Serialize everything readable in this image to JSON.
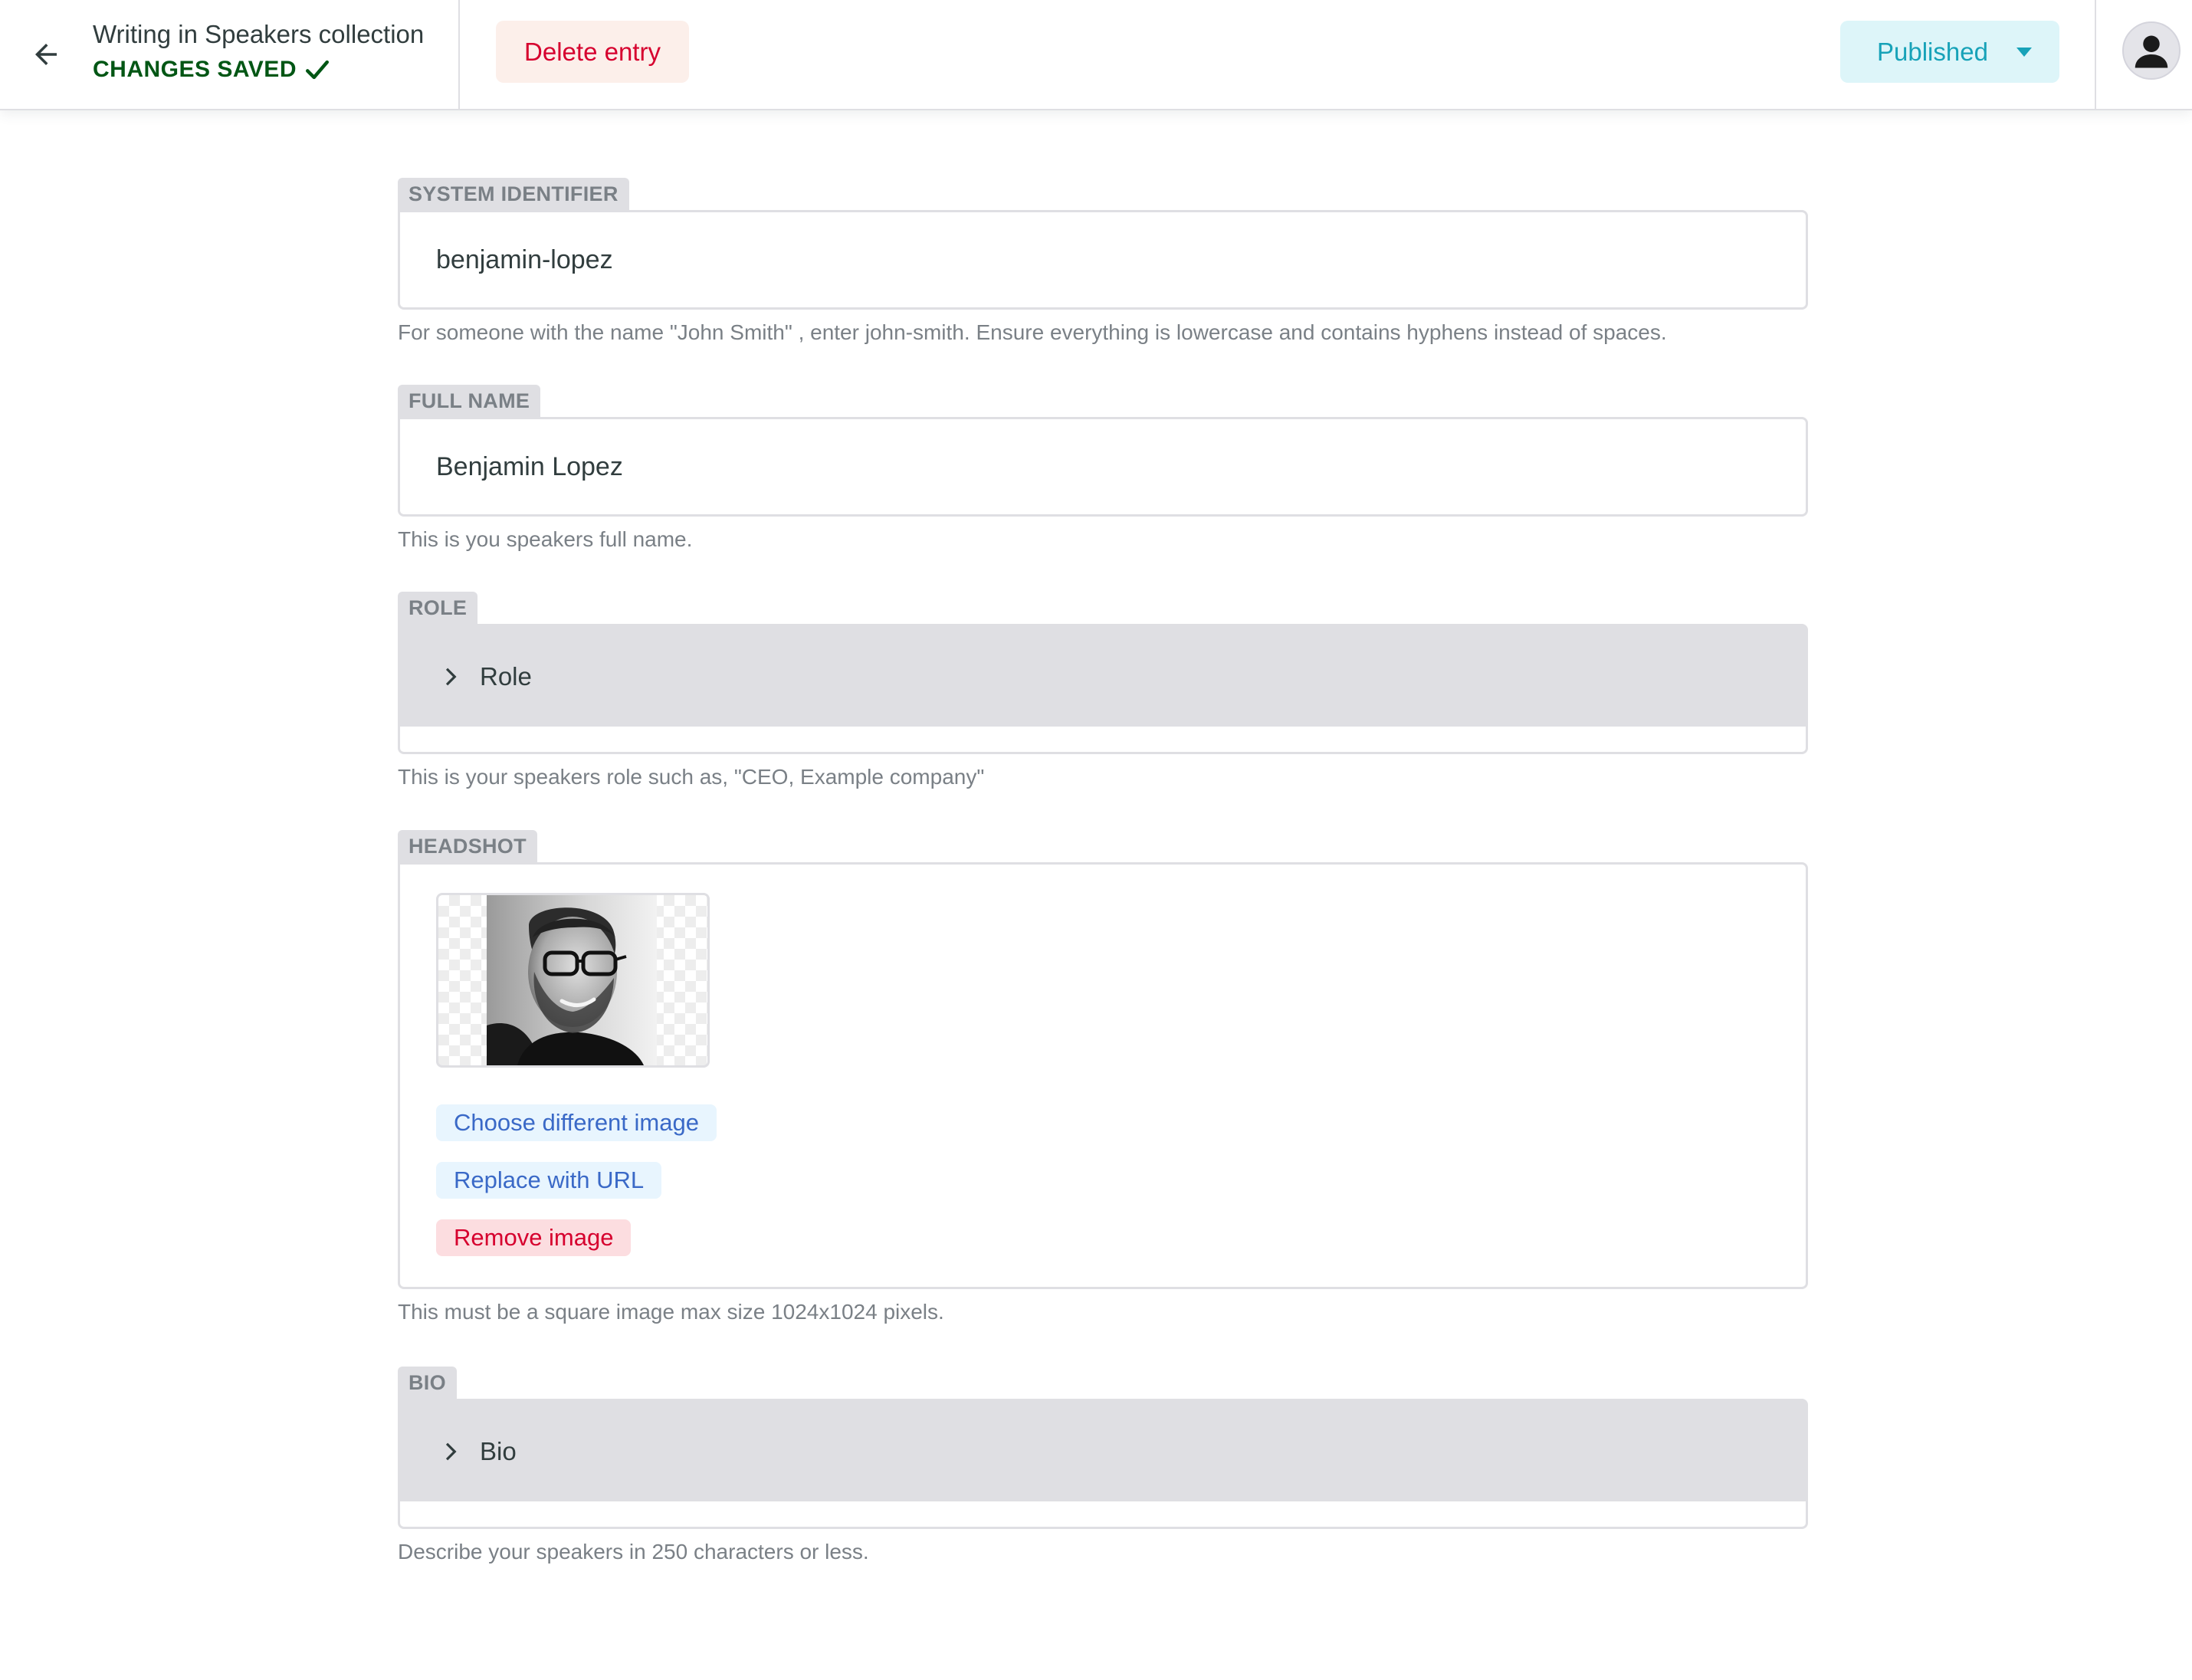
{
  "header": {
    "back_icon": "arrow-left-icon",
    "collection_title": "Writing in Speakers collection",
    "save_status": "CHANGES SAVED",
    "save_status_icon": "checkmark-icon",
    "save_status_color": "#005614",
    "delete_label": "Delete entry",
    "publish_status": "Published",
    "publish_dropdown_icon": "caret-down-icon",
    "avatar_icon": "user-avatar-icon"
  },
  "fields": {
    "system_identifier": {
      "label": "SYSTEM IDENTIFIER",
      "value": "benjamin-lopez",
      "hint": "For someone with the name \"John Smith\" , enter john-smith. Ensure everything is lowercase and contains hyphens instead of spaces."
    },
    "full_name": {
      "label": "FULL NAME",
      "value": "Benjamin Lopez",
      "hint": "This is you speakers full name."
    },
    "role": {
      "label": "ROLE",
      "collapsed_title": "Role",
      "expand_icon": "chevron-right-icon",
      "hint": "This is your speakers role such as, \"CEO, Example company\""
    },
    "headshot": {
      "label": "HEADSHOT",
      "choose_label": "Choose different image",
      "replace_label": "Replace with URL",
      "remove_label": "Remove image",
      "hint": "This must be a square image max size 1024x1024 pixels."
    },
    "bio": {
      "label": "BIO",
      "collapsed_title": "Bio",
      "expand_icon": "chevron-right-icon",
      "hint": "Describe your speakers in 250 characters or less."
    }
  },
  "colors": {
    "delete_text": "#d6002e",
    "publish_text": "#17a2b8",
    "link_blue": "#3a69c7",
    "label_bg": "#dfdfe3"
  }
}
